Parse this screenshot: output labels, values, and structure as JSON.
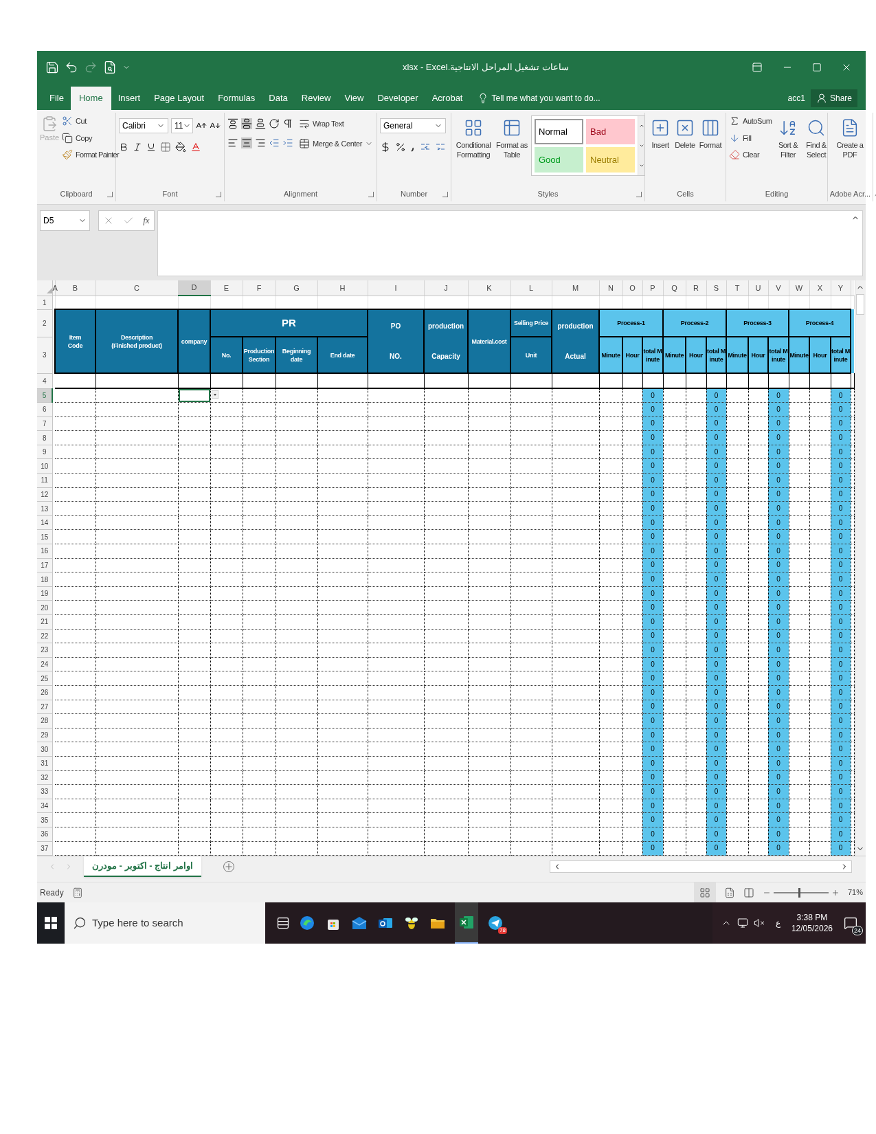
{
  "window": {
    "title": "ساعات تشغيل المراحل الانتاجية.xlsx - Excel"
  },
  "tabs": [
    {
      "label": "File",
      "selected": false
    },
    {
      "label": "Home",
      "selected": true
    },
    {
      "label": "Insert",
      "selected": false
    },
    {
      "label": "Page Layout",
      "selected": false
    },
    {
      "label": "Formulas",
      "selected": false
    },
    {
      "label": "Data",
      "selected": false
    },
    {
      "label": "Review",
      "selected": false
    },
    {
      "label": "View",
      "selected": false
    },
    {
      "label": "Developer",
      "selected": false
    },
    {
      "label": "Acrobat",
      "selected": false
    }
  ],
  "tell_me": "Tell me what you want to do...",
  "user": "acc1",
  "share": "Share",
  "clipboard": {
    "paste": "Paste",
    "paste_disabled": true,
    "cut": "Cut",
    "copy": "Copy",
    "format_painter": "Format Painter",
    "label": "Clipboard"
  },
  "font": {
    "name": "Calibri",
    "size": "11",
    "label": "Font"
  },
  "alignment": {
    "wrap": "Wrap Text",
    "merge": "Merge & Center",
    "label": "Alignment"
  },
  "number": {
    "format": "General",
    "label": "Number"
  },
  "styles": {
    "conditional": "Conditional Formatting",
    "table": "Format as Table",
    "label": "Styles",
    "cells": [
      {
        "text": "Normal",
        "color": "#ffffff",
        "selected": true
      },
      {
        "text": "Bad",
        "color": "#ffc7ce",
        "selected": false
      },
      {
        "text": "Good",
        "color": "#c6efce",
        "selected": false
      },
      {
        "text": "Neutral",
        "color": "#ffeb9c",
        "selected": false
      }
    ]
  },
  "cells_group": {
    "insert": "Insert",
    "delete": "Delete",
    "format": "Format",
    "label": "Cells"
  },
  "editing": {
    "autosum": "AutoSum",
    "fill": "Fill",
    "clear": "Clear",
    "sort": "Sort & Filter",
    "find": "Find & Select",
    "label": "Editing"
  },
  "adobe": {
    "create": "Create a PDF",
    "label": "Adobe Acr..."
  },
  "formula_bar": {
    "name_box": "D5",
    "fx": "fx"
  },
  "columns": [
    {
      "letter": "A",
      "selected": false
    },
    {
      "letter": "B",
      "selected": false
    },
    {
      "letter": "C",
      "selected": false
    },
    {
      "letter": "D",
      "selected": true
    },
    {
      "letter": "E",
      "selected": false
    },
    {
      "letter": "F",
      "selected": false
    },
    {
      "letter": "G",
      "selected": false
    },
    {
      "letter": "H",
      "selected": false
    },
    {
      "letter": "I",
      "selected": false
    },
    {
      "letter": "J",
      "selected": false
    },
    {
      "letter": "K",
      "selected": false
    },
    {
      "letter": "L",
      "selected": false
    },
    {
      "letter": "M",
      "selected": false
    },
    {
      "letter": "N",
      "selected": false
    },
    {
      "letter": "O",
      "selected": false
    },
    {
      "letter": "P",
      "selected": false
    },
    {
      "letter": "Q",
      "selected": false
    },
    {
      "letter": "R",
      "selected": false
    },
    {
      "letter": "S",
      "selected": false
    },
    {
      "letter": "T",
      "selected": false
    },
    {
      "letter": "U",
      "selected": false
    },
    {
      "letter": "V",
      "selected": false
    },
    {
      "letter": "W",
      "selected": false
    },
    {
      "letter": "X",
      "selected": false
    },
    {
      "letter": "Y",
      "selected": false
    }
  ],
  "header_row_numbers": [
    "1",
    "2",
    "3"
  ],
  "header": {
    "item": [
      "Item",
      "Code"
    ],
    "description": [
      "Description",
      "(Finished product)"
    ],
    "company": [
      "company"
    ],
    "pr": {
      "title": "PR",
      "sub": [
        [
          "No."
        ],
        [
          "Production",
          "Section"
        ],
        [
          "Beginning date"
        ],
        [
          "End date"
        ]
      ]
    },
    "po": [
      "PO",
      "NO."
    ],
    "capacity": [
      "production",
      "Capacity"
    ],
    "material": [
      "Material.cost"
    ],
    "selling": {
      "top": "Selling Price",
      "bottom": "Unit"
    },
    "actual": [
      "production",
      "Actual"
    ],
    "processes": [
      {
        "title": "Process-1",
        "sub": [
          "Minute",
          "Hour",
          "total Minute"
        ]
      },
      {
        "title": "Process-2",
        "sub": [
          "Minute",
          "Hour",
          "total Minute"
        ]
      },
      {
        "title": "Process-3",
        "sub": [
          "Minute",
          "Hour",
          "total Minute"
        ]
      },
      {
        "title": "Process-4",
        "sub": [
          "Minute",
          "Hour",
          "total Minute"
        ]
      }
    ]
  },
  "rows": [
    {
      "number": "4",
      "selected": false
    },
    {
      "number": "5",
      "selected": true,
      "totals": [
        "0",
        "0",
        "0",
        "0"
      ]
    },
    {
      "number": "6",
      "selected": false,
      "totals": [
        "0",
        "0",
        "0",
        "0"
      ]
    },
    {
      "number": "7",
      "selected": false,
      "totals": [
        "0",
        "0",
        "0",
        "0"
      ]
    },
    {
      "number": "8",
      "selected": false,
      "totals": [
        "0",
        "0",
        "0",
        "0"
      ]
    },
    {
      "number": "9",
      "selected": false,
      "totals": [
        "0",
        "0",
        "0",
        "0"
      ]
    },
    {
      "number": "10",
      "selected": false,
      "totals": [
        "0",
        "0",
        "0",
        "0"
      ]
    },
    {
      "number": "11",
      "selected": false,
      "totals": [
        "0",
        "0",
        "0",
        "0"
      ]
    },
    {
      "number": "12",
      "selected": false,
      "totals": [
        "0",
        "0",
        "0",
        "0"
      ]
    },
    {
      "number": "13",
      "selected": false,
      "totals": [
        "0",
        "0",
        "0",
        "0"
      ]
    },
    {
      "number": "14",
      "selected": false,
      "totals": [
        "0",
        "0",
        "0",
        "0"
      ]
    },
    {
      "number": "15",
      "selected": false,
      "totals": [
        "0",
        "0",
        "0",
        "0"
      ]
    },
    {
      "number": "16",
      "selected": false,
      "totals": [
        "0",
        "0",
        "0",
        "0"
      ]
    },
    {
      "number": "17",
      "selected": false,
      "totals": [
        "0",
        "0",
        "0",
        "0"
      ]
    },
    {
      "number": "18",
      "selected": false,
      "totals": [
        "0",
        "0",
        "0",
        "0"
      ]
    },
    {
      "number": "19",
      "selected": false,
      "totals": [
        "0",
        "0",
        "0",
        "0"
      ]
    },
    {
      "number": "20",
      "selected": false,
      "totals": [
        "0",
        "0",
        "0",
        "0"
      ]
    },
    {
      "number": "21",
      "selected": false,
      "totals": [
        "0",
        "0",
        "0",
        "0"
      ]
    },
    {
      "number": "22",
      "selected": false,
      "totals": [
        "0",
        "0",
        "0",
        "0"
      ]
    },
    {
      "number": "23",
      "selected": false,
      "totals": [
        "0",
        "0",
        "0",
        "0"
      ]
    },
    {
      "number": "24",
      "selected": false,
      "totals": [
        "0",
        "0",
        "0",
        "0"
      ]
    },
    {
      "number": "25",
      "selected": false,
      "totals": [
        "0",
        "0",
        "0",
        "0"
      ]
    },
    {
      "number": "26",
      "selected": false,
      "totals": [
        "0",
        "0",
        "0",
        "0"
      ]
    },
    {
      "number": "27",
      "selected": false,
      "totals": [
        "0",
        "0",
        "0",
        "0"
      ]
    },
    {
      "number": "28",
      "selected": false,
      "totals": [
        "0",
        "0",
        "0",
        "0"
      ]
    },
    {
      "number": "29",
      "selected": false,
      "totals": [
        "0",
        "0",
        "0",
        "0"
      ]
    },
    {
      "number": "30",
      "selected": false,
      "totals": [
        "0",
        "0",
        "0",
        "0"
      ]
    },
    {
      "number": "31",
      "selected": false,
      "totals": [
        "0",
        "0",
        "0",
        "0"
      ]
    },
    {
      "number": "32",
      "selected": false,
      "totals": [
        "0",
        "0",
        "0",
        "0"
      ]
    },
    {
      "number": "33",
      "selected": false,
      "totals": [
        "0",
        "0",
        "0",
        "0"
      ]
    },
    {
      "number": "34",
      "selected": false,
      "totals": [
        "0",
        "0",
        "0",
        "0"
      ]
    },
    {
      "number": "35",
      "selected": false,
      "totals": [
        "0",
        "0",
        "0",
        "0"
      ]
    },
    {
      "number": "36",
      "selected": false,
      "totals": [
        "0",
        "0",
        "0",
        "0"
      ]
    },
    {
      "number": "37",
      "selected": false,
      "totals": [
        "0",
        "0",
        "0",
        "0"
      ]
    }
  ],
  "sheet_tabs": [
    {
      "label": "اوامر انتاج - اكتوبر - مودرن",
      "selected": true
    }
  ],
  "status": "Ready",
  "zoom": {
    "level": 0.45,
    "text": "71%"
  },
  "taskbar": {
    "search_placeholder": "Type here to search",
    "language": "ع",
    "time": "3:38 PM",
    "date": "12/05/2026",
    "notifications": "24",
    "app_badge": "78"
  }
}
